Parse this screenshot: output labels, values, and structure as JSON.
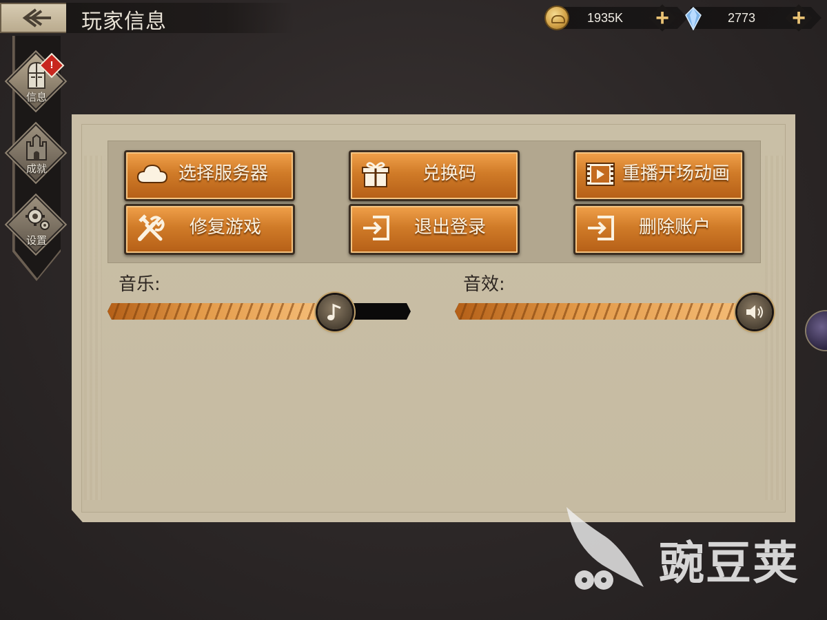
{
  "header": {
    "title": "玩家信息",
    "coins": "1935K",
    "gems": "2773",
    "add_symbol": "+"
  },
  "sidebar": {
    "items": [
      {
        "label": "信息",
        "icon": "helmet-icon",
        "active": true,
        "alert": "!"
      },
      {
        "label": "成就",
        "icon": "castle-icon",
        "active": false
      },
      {
        "label": "设置",
        "icon": "gears-icon",
        "active": false
      }
    ]
  },
  "buttons": [
    {
      "label": "选择服务器",
      "icon": "cloud-icon"
    },
    {
      "label": "兑换码",
      "icon": "gift-icon"
    },
    {
      "label": "重播开场动画",
      "icon": "film-icon"
    },
    {
      "label": "修复游戏",
      "icon": "wrench-hammer-icon"
    },
    {
      "label": "退出登录",
      "icon": "login-arrow-icon"
    },
    {
      "label": "删除账户",
      "icon": "login-arrow-icon"
    }
  ],
  "volume": {
    "music_label": "音乐:",
    "music_level": 0.75,
    "sfx_label": "音效:",
    "sfx_level": 1.0
  },
  "watermark": {
    "text": "豌豆荚"
  },
  "colors": {
    "button_orange": "#d07b28",
    "panel_bg": "#c9bea6",
    "background": "#2c2727",
    "accent_gold": "#e9c274"
  }
}
